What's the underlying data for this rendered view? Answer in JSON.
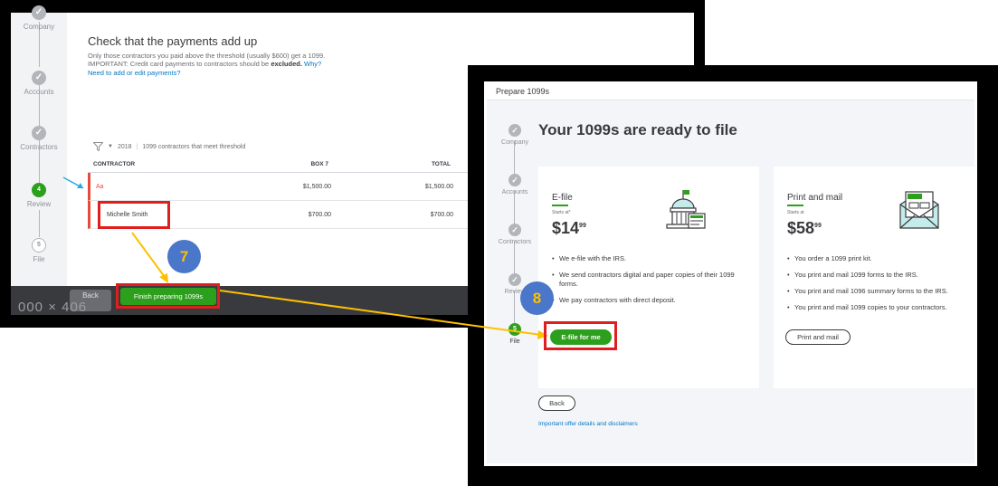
{
  "left": {
    "steps": [
      {
        "label": "Company",
        "marker": "✓"
      },
      {
        "label": "Accounts",
        "marker": "✓"
      },
      {
        "label": "Contractors",
        "marker": "✓"
      },
      {
        "label": "Review",
        "marker": "4"
      },
      {
        "label": "File",
        "marker": "5"
      }
    ],
    "title": "Check that the payments add up",
    "desc1": "Only those contractors you paid above the threshold (usually $600) get a 1099.",
    "desc2_prefix": "IMPORTANT: Credit card payments to contractors should be ",
    "desc2_bold": "excluded.",
    "desc2_link": "Why?",
    "desc3": "Need to add or edit payments?",
    "filter_year": "2018",
    "filter_label": "1099 contractors that meet threshold",
    "table": {
      "headers": [
        "CONTRACTOR",
        "BOX 7",
        "TOTAL"
      ],
      "rows": [
        [
          "Aa",
          "$1,500.00",
          "$1,500.00"
        ],
        [
          "Michelle Smith",
          "$700.00",
          "$700.00"
        ]
      ]
    },
    "back_label": "Back",
    "finish_label": "Finish preparing 1099s",
    "overlay_text": "000 × 406"
  },
  "right": {
    "header": "Prepare 1099s",
    "steps": [
      {
        "label": "Company",
        "marker": "✓"
      },
      {
        "label": "Accounts",
        "marker": "✓"
      },
      {
        "label": "Contractors",
        "marker": "✓"
      },
      {
        "label": "Review",
        "marker": "✓"
      },
      {
        "label": "File",
        "marker": "5"
      }
    ],
    "title": "Your 1099s are ready to file",
    "efile": {
      "title": "E-file",
      "starts": "Starts at*",
      "price_main": "$14",
      "price_cents": "99",
      "bullets": [
        "We e-file with the IRS.",
        "We send contractors digital and paper copies of their 1099 forms.",
        "We pay contractors with direct deposit."
      ],
      "button": "E-file for me"
    },
    "print": {
      "title": "Print and mail",
      "starts": "Starts at",
      "price_main": "$58",
      "price_cents": "99",
      "bullets": [
        "You order a 1099 print kit.",
        "You print and mail 1099 forms to the IRS.",
        "You print and mail 1096 summary forms to the IRS.",
        "You print and mail 1099 copies to your contractors."
      ],
      "button": "Print and mail"
    },
    "back_label": "Back",
    "disclaimer": "Important offer details and disclaimers"
  },
  "annotations": {
    "step7": "7",
    "step8": "8",
    "arrow_color": "#ffc000",
    "highlight_color": "#e01e1e"
  }
}
